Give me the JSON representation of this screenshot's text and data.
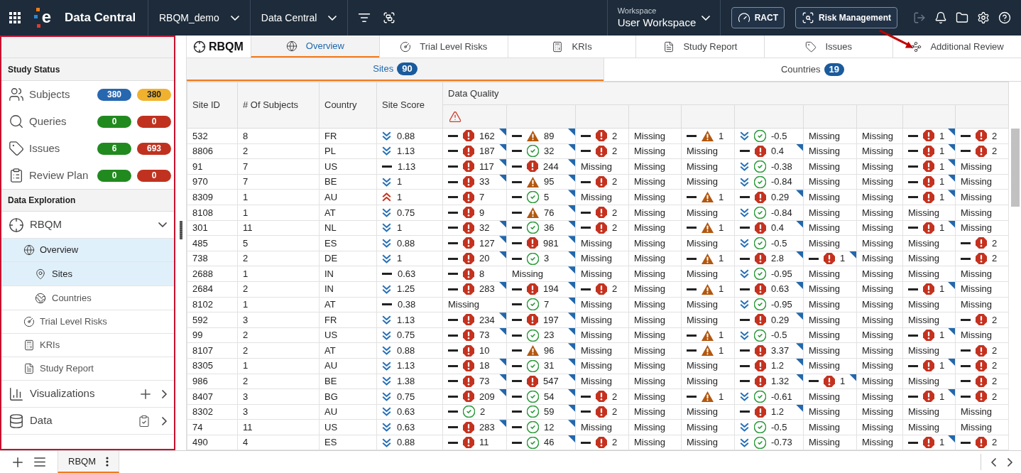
{
  "top_bar": {
    "logo_letter": "e",
    "app_name": "Data Central",
    "selectors": [
      {
        "label": "RBQM_demo"
      },
      {
        "label": "Data Central"
      }
    ],
    "workspace": {
      "label": "Workspace",
      "value": "User Workspace"
    },
    "buttons": [
      {
        "kind": "ract",
        "label": "RACT"
      },
      {
        "kind": "risk_management",
        "label": "Risk Management"
      }
    ],
    "actions": [
      {
        "kind": "logout",
        "disabled": true
      },
      {
        "kind": "notifications",
        "disabled": false
      },
      {
        "kind": "folder",
        "disabled": false
      },
      {
        "kind": "settings",
        "disabled": false
      },
      {
        "kind": "help",
        "disabled": false
      }
    ]
  },
  "study_status": {
    "title": "Study Status",
    "items": [
      {
        "kind": "subjects",
        "label": "Subjects",
        "badges": [
          {
            "text": "380",
            "color": "#2767b0"
          },
          {
            "text": "380",
            "color": "#f0b22e"
          }
        ]
      },
      {
        "kind": "queries",
        "label": "Queries",
        "badges": [
          {
            "text": "0",
            "color": "#218a1f"
          },
          {
            "text": "0",
            "color": "#c0321f"
          }
        ]
      },
      {
        "kind": "issues",
        "label": "Issues",
        "badges": [
          {
            "text": "6",
            "color": "#218a1f"
          },
          {
            "text": "693",
            "color": "#c0321f"
          }
        ]
      },
      {
        "kind": "review_plan",
        "label": "Review Plan",
        "badges": [
          {
            "text": "0",
            "color": "#218a1f"
          },
          {
            "text": "0",
            "color": "#c0321f"
          }
        ]
      }
    ]
  },
  "data_exploration": {
    "title": "Data Exploration",
    "items": [
      {
        "kind": "rbqm",
        "label": "RBQM",
        "selected": false,
        "expanded": true,
        "children": [
          {
            "kind": "overview",
            "label": "Overview",
            "selected": true,
            "children": [
              {
                "kind": "sites",
                "label": "Sites",
                "selected": true
              },
              {
                "kind": "countries",
                "label": "Countries",
                "selected": false
              }
            ]
          },
          {
            "kind": "trial_level_risks",
            "label": "Trial Level Risks",
            "selected": false
          },
          {
            "kind": "kris",
            "label": "KRIs",
            "selected": false
          },
          {
            "kind": "study_report",
            "label": "Study Report",
            "selected": false
          }
        ]
      },
      {
        "kind": "visualizations",
        "label": "Visualizations",
        "selected": false,
        "expanded": false
      },
      {
        "kind": "data",
        "label": "Data",
        "selected": false,
        "expanded": false
      }
    ]
  },
  "module": {
    "title": "RBQM",
    "tabs": [
      {
        "kind": "overview",
        "label": "Overview",
        "selected": true
      },
      {
        "kind": "trial_level_risks",
        "label": "Trial Level Risks",
        "selected": false
      },
      {
        "kind": "kris",
        "label": "KRIs",
        "selected": false
      },
      {
        "kind": "study_report",
        "label": "Study Report",
        "selected": false
      },
      {
        "kind": "issues",
        "label": "Issues",
        "selected": false
      },
      {
        "kind": "additional_review",
        "label": "Additional Review",
        "selected": false
      }
    ]
  },
  "sub_tabs": [
    {
      "label": "Sites",
      "count": "90",
      "selected": true
    },
    {
      "label": "Countries",
      "count": "19",
      "selected": false
    }
  ],
  "table": {
    "columns": [
      {
        "label": "Site ID"
      },
      {
        "label": "# Of Subjects"
      },
      {
        "label": "Country"
      },
      {
        "label": "Site Score"
      }
    ],
    "group": {
      "label": "Data Quality",
      "columns": [
        {
          "alert": true
        },
        {
          "alert": false
        },
        {
          "alert": false
        },
        {
          "alert": false
        },
        {
          "alert": false
        },
        {
          "alert": false
        },
        {
          "alert": false
        },
        {
          "alert": false
        },
        {
          "alert": false
        },
        {
          "alert": false
        }
      ]
    },
    "rows": [
      {
        "site_id": "532",
        "subjects": "8",
        "country": "FR",
        "score": {
          "kind": "down",
          "value": "0.88"
        },
        "quality": [
          {
            "kind": "flat_error",
            "value": "162",
            "flagged": true
          },
          {
            "kind": "flat_warning",
            "value": "89",
            "flagged": true
          },
          {
            "kind": "flat_error",
            "value": "2",
            "flagged": false
          },
          {
            "kind": "missing",
            "text": "Missing",
            "flagged": false
          },
          {
            "kind": "flat_warning",
            "value": "1",
            "flagged": false
          },
          {
            "kind": "down_ok",
            "value": "-0.5",
            "flagged": false
          },
          {
            "kind": "missing",
            "text": "Missing",
            "flagged": false
          },
          {
            "kind": "missing",
            "text": "Missing",
            "flagged": false
          },
          {
            "kind": "flat_error",
            "value": "1",
            "flagged": true
          },
          {
            "kind": "flat_error",
            "value": "2",
            "flagged": false
          }
        ]
      },
      {
        "site_id": "8806",
        "subjects": "2",
        "country": "PL",
        "score": {
          "kind": "down",
          "value": "1.13"
        },
        "quality": [
          {
            "kind": "flat_error",
            "value": "187",
            "flagged": true
          },
          {
            "kind": "flat_ok",
            "value": "32",
            "flagged": true
          },
          {
            "kind": "flat_error",
            "value": "2",
            "flagged": false
          },
          {
            "kind": "missing",
            "text": "Missing",
            "flagged": false
          },
          {
            "kind": "missing",
            "text": "Missing",
            "flagged": false
          },
          {
            "kind": "flat_error",
            "value": "0.4",
            "flagged": true
          },
          {
            "kind": "missing",
            "text": "Missing",
            "flagged": false
          },
          {
            "kind": "missing",
            "text": "Missing",
            "flagged": false
          },
          {
            "kind": "flat_error",
            "value": "1",
            "flagged": true
          },
          {
            "kind": "flat_error",
            "value": "2",
            "flagged": false
          }
        ]
      },
      {
        "site_id": "91",
        "subjects": "7",
        "country": "US",
        "score": {
          "kind": "flat",
          "value": "1.13"
        },
        "quality": [
          {
            "kind": "flat_error",
            "value": "117",
            "flagged": true
          },
          {
            "kind": "flat_error",
            "value": "244",
            "flagged": true
          },
          {
            "kind": "missing",
            "text": "Missing",
            "flagged": false
          },
          {
            "kind": "missing",
            "text": "Missing",
            "flagged": false
          },
          {
            "kind": "missing",
            "text": "Missing",
            "flagged": false
          },
          {
            "kind": "down_ok",
            "value": "-0.38",
            "flagged": false
          },
          {
            "kind": "missing",
            "text": "Missing",
            "flagged": false
          },
          {
            "kind": "missing",
            "text": "Missing",
            "flagged": false
          },
          {
            "kind": "flat_error",
            "value": "1",
            "flagged": true
          },
          {
            "kind": "missing",
            "text": "Missing",
            "flagged": false
          }
        ]
      },
      {
        "site_id": "970",
        "subjects": "7",
        "country": "BE",
        "score": {
          "kind": "down",
          "value": "1"
        },
        "quality": [
          {
            "kind": "flat_error",
            "value": "33",
            "flagged": true
          },
          {
            "kind": "flat_warning",
            "value": "95",
            "flagged": true
          },
          {
            "kind": "flat_error",
            "value": "2",
            "flagged": false
          },
          {
            "kind": "missing",
            "text": "Missing",
            "flagged": false
          },
          {
            "kind": "missing",
            "text": "Missing",
            "flagged": false
          },
          {
            "kind": "down_ok",
            "value": "-0.84",
            "flagged": false
          },
          {
            "kind": "missing",
            "text": "Missing",
            "flagged": false
          },
          {
            "kind": "missing",
            "text": "Missing",
            "flagged": false
          },
          {
            "kind": "flat_error",
            "value": "1",
            "flagged": true
          },
          {
            "kind": "missing",
            "text": "Missing",
            "flagged": false
          }
        ]
      },
      {
        "site_id": "8309",
        "subjects": "1",
        "country": "AU",
        "score": {
          "kind": "up",
          "value": "1"
        },
        "quality": [
          {
            "kind": "flat_error",
            "value": "7",
            "flagged": false
          },
          {
            "kind": "flat_ok",
            "value": "5",
            "flagged": true
          },
          {
            "kind": "missing",
            "text": "Missing",
            "flagged": false
          },
          {
            "kind": "missing",
            "text": "Missing",
            "flagged": false
          },
          {
            "kind": "flat_warning",
            "value": "1",
            "flagged": false
          },
          {
            "kind": "flat_error",
            "value": "0.29",
            "flagged": true
          },
          {
            "kind": "missing",
            "text": "Missing",
            "flagged": false
          },
          {
            "kind": "missing",
            "text": "Missing",
            "flagged": false
          },
          {
            "kind": "flat_error",
            "value": "1",
            "flagged": true
          },
          {
            "kind": "missing",
            "text": "Missing",
            "flagged": false
          }
        ]
      },
      {
        "site_id": "8108",
        "subjects": "1",
        "country": "AT",
        "score": {
          "kind": "down",
          "value": "0.75"
        },
        "quality": [
          {
            "kind": "flat_error",
            "value": "9",
            "flagged": false
          },
          {
            "kind": "flat_warning",
            "value": "76",
            "flagged": true
          },
          {
            "kind": "flat_error",
            "value": "2",
            "flagged": false
          },
          {
            "kind": "missing",
            "text": "Missing",
            "flagged": false
          },
          {
            "kind": "missing",
            "text": "Missing",
            "flagged": false
          },
          {
            "kind": "down_ok",
            "value": "-0.84",
            "flagged": false
          },
          {
            "kind": "missing",
            "text": "Missing",
            "flagged": false
          },
          {
            "kind": "missing",
            "text": "Missing",
            "flagged": false
          },
          {
            "kind": "missing",
            "text": "Missing",
            "flagged": false
          },
          {
            "kind": "missing",
            "text": "Missing",
            "flagged": false
          }
        ]
      },
      {
        "site_id": "301",
        "subjects": "11",
        "country": "NL",
        "score": {
          "kind": "down",
          "value": "1"
        },
        "quality": [
          {
            "kind": "flat_error",
            "value": "32",
            "flagged": true
          },
          {
            "kind": "flat_ok",
            "value": "36",
            "flagged": true
          },
          {
            "kind": "flat_error",
            "value": "2",
            "flagged": false
          },
          {
            "kind": "missing",
            "text": "Missing",
            "flagged": false
          },
          {
            "kind": "flat_warning",
            "value": "1",
            "flagged": false
          },
          {
            "kind": "flat_error",
            "value": "0.4",
            "flagged": true
          },
          {
            "kind": "missing",
            "text": "Missing",
            "flagged": false
          },
          {
            "kind": "missing",
            "text": "Missing",
            "flagged": false
          },
          {
            "kind": "flat_error",
            "value": "1",
            "flagged": true
          },
          {
            "kind": "missing",
            "text": "Missing",
            "flagged": false
          }
        ]
      },
      {
        "site_id": "485",
        "subjects": "5",
        "country": "ES",
        "score": {
          "kind": "down",
          "value": "0.88"
        },
        "quality": [
          {
            "kind": "flat_error",
            "value": "127",
            "flagged": true
          },
          {
            "kind": "flat_error",
            "value": "981",
            "flagged": true
          },
          {
            "kind": "missing",
            "text": "Missing",
            "flagged": false
          },
          {
            "kind": "missing",
            "text": "Missing",
            "flagged": false
          },
          {
            "kind": "missing",
            "text": "Missing",
            "flagged": false
          },
          {
            "kind": "down_ok",
            "value": "-0.5",
            "flagged": false
          },
          {
            "kind": "missing",
            "text": "Missing",
            "flagged": false
          },
          {
            "kind": "missing",
            "text": "Missing",
            "flagged": false
          },
          {
            "kind": "missing",
            "text": "Missing",
            "flagged": false
          },
          {
            "kind": "flat_error",
            "value": "2",
            "flagged": false
          }
        ]
      },
      {
        "site_id": "738",
        "subjects": "2",
        "country": "DE",
        "score": {
          "kind": "down",
          "value": "1"
        },
        "quality": [
          {
            "kind": "flat_error",
            "value": "20",
            "flagged": true
          },
          {
            "kind": "flat_ok",
            "value": "3",
            "flagged": true
          },
          {
            "kind": "missing",
            "text": "Missing",
            "flagged": false
          },
          {
            "kind": "missing",
            "text": "Missing",
            "flagged": false
          },
          {
            "kind": "flat_warning",
            "value": "1",
            "flagged": false
          },
          {
            "kind": "flat_error",
            "value": "2.8",
            "flagged": true
          },
          {
            "kind": "flat_error",
            "value": "1",
            "flagged": true
          },
          {
            "kind": "missing",
            "text": "Missing",
            "flagged": false
          },
          {
            "kind": "missing",
            "text": "Missing",
            "flagged": false
          },
          {
            "kind": "flat_error",
            "value": "2",
            "flagged": false
          }
        ]
      },
      {
        "site_id": "2688",
        "subjects": "1",
        "country": "IN",
        "score": {
          "kind": "flat",
          "value": "0.63"
        },
        "quality": [
          {
            "kind": "flat_error",
            "value": "8",
            "flagged": false
          },
          {
            "kind": "missing",
            "text": "Missing",
            "flagged": true
          },
          {
            "kind": "missing",
            "text": "Missing",
            "flagged": false
          },
          {
            "kind": "missing",
            "text": "Missing",
            "flagged": false
          },
          {
            "kind": "missing",
            "text": "Missing",
            "flagged": false
          },
          {
            "kind": "down_ok",
            "value": "-0.95",
            "flagged": false
          },
          {
            "kind": "missing",
            "text": "Missing",
            "flagged": false
          },
          {
            "kind": "missing",
            "text": "Missing",
            "flagged": false
          },
          {
            "kind": "missing",
            "text": "Missing",
            "flagged": false
          },
          {
            "kind": "missing",
            "text": "Missing",
            "flagged": false
          }
        ]
      },
      {
        "site_id": "2684",
        "subjects": "2",
        "country": "IN",
        "score": {
          "kind": "down",
          "value": "1.25"
        },
        "quality": [
          {
            "kind": "flat_error",
            "value": "283",
            "flagged": true
          },
          {
            "kind": "flat_error",
            "value": "194",
            "flagged": true
          },
          {
            "kind": "flat_error",
            "value": "2",
            "flagged": false
          },
          {
            "kind": "missing",
            "text": "Missing",
            "flagged": false
          },
          {
            "kind": "flat_warning",
            "value": "1",
            "flagged": false
          },
          {
            "kind": "flat_error",
            "value": "0.63",
            "flagged": true
          },
          {
            "kind": "missing",
            "text": "Missing",
            "flagged": false
          },
          {
            "kind": "missing",
            "text": "Missing",
            "flagged": false
          },
          {
            "kind": "flat_error",
            "value": "1",
            "flagged": true
          },
          {
            "kind": "missing",
            "text": "Missing",
            "flagged": false
          }
        ]
      },
      {
        "site_id": "8102",
        "subjects": "1",
        "country": "AT",
        "score": {
          "kind": "flat",
          "value": "0.38"
        },
        "quality": [
          {
            "kind": "missing",
            "text": "Missing",
            "flagged": false
          },
          {
            "kind": "flat_ok",
            "value": "7",
            "flagged": true
          },
          {
            "kind": "missing",
            "text": "Missing",
            "flagged": false
          },
          {
            "kind": "missing",
            "text": "Missing",
            "flagged": false
          },
          {
            "kind": "missing",
            "text": "Missing",
            "flagged": false
          },
          {
            "kind": "down_ok",
            "value": "-0.95",
            "flagged": false
          },
          {
            "kind": "missing",
            "text": "Missing",
            "flagged": false
          },
          {
            "kind": "missing",
            "text": "Missing",
            "flagged": false
          },
          {
            "kind": "missing",
            "text": "Missing",
            "flagged": false
          },
          {
            "kind": "missing",
            "text": "Missing",
            "flagged": false
          }
        ]
      },
      {
        "site_id": "592",
        "subjects": "3",
        "country": "FR",
        "score": {
          "kind": "down",
          "value": "1.13"
        },
        "quality": [
          {
            "kind": "flat_error",
            "value": "234",
            "flagged": true
          },
          {
            "kind": "flat_error",
            "value": "197",
            "flagged": true
          },
          {
            "kind": "missing",
            "text": "Missing",
            "flagged": false
          },
          {
            "kind": "missing",
            "text": "Missing",
            "flagged": false
          },
          {
            "kind": "missing",
            "text": "Missing",
            "flagged": false
          },
          {
            "kind": "flat_error",
            "value": "0.29",
            "flagged": true
          },
          {
            "kind": "missing",
            "text": "Missing",
            "flagged": false
          },
          {
            "kind": "missing",
            "text": "Missing",
            "flagged": false
          },
          {
            "kind": "missing",
            "text": "Missing",
            "flagged": false
          },
          {
            "kind": "flat_error",
            "value": "2",
            "flagged": false
          }
        ]
      },
      {
        "site_id": "99",
        "subjects": "2",
        "country": "US",
        "score": {
          "kind": "down",
          "value": "0.75"
        },
        "quality": [
          {
            "kind": "flat_error",
            "value": "73",
            "flagged": true
          },
          {
            "kind": "flat_ok",
            "value": "23",
            "flagged": true
          },
          {
            "kind": "missing",
            "text": "Missing",
            "flagged": false
          },
          {
            "kind": "missing",
            "text": "Missing",
            "flagged": false
          },
          {
            "kind": "flat_warning",
            "value": "1",
            "flagged": false
          },
          {
            "kind": "down_ok",
            "value": "-0.5",
            "flagged": false
          },
          {
            "kind": "missing",
            "text": "Missing",
            "flagged": false
          },
          {
            "kind": "missing",
            "text": "Missing",
            "flagged": false
          },
          {
            "kind": "flat_error",
            "value": "1",
            "flagged": true
          },
          {
            "kind": "missing",
            "text": "Missing",
            "flagged": false
          }
        ]
      },
      {
        "site_id": "8107",
        "subjects": "2",
        "country": "AT",
        "score": {
          "kind": "down",
          "value": "0.88"
        },
        "quality": [
          {
            "kind": "flat_error",
            "value": "10",
            "flagged": false
          },
          {
            "kind": "flat_warning",
            "value": "96",
            "flagged": true
          },
          {
            "kind": "missing",
            "text": "Missing",
            "flagged": false
          },
          {
            "kind": "missing",
            "text": "Missing",
            "flagged": false
          },
          {
            "kind": "flat_warning",
            "value": "1",
            "flagged": false
          },
          {
            "kind": "flat_error",
            "value": "3.37",
            "flagged": true
          },
          {
            "kind": "missing",
            "text": "Missing",
            "flagged": false
          },
          {
            "kind": "missing",
            "text": "Missing",
            "flagged": false
          },
          {
            "kind": "missing",
            "text": "Missing",
            "flagged": false
          },
          {
            "kind": "flat_error",
            "value": "2",
            "flagged": false
          }
        ]
      },
      {
        "site_id": "8305",
        "subjects": "1",
        "country": "AU",
        "score": {
          "kind": "down",
          "value": "1.13"
        },
        "quality": [
          {
            "kind": "flat_error",
            "value": "18",
            "flagged": true
          },
          {
            "kind": "flat_ok",
            "value": "31",
            "flagged": true
          },
          {
            "kind": "missing",
            "text": "Missing",
            "flagged": false
          },
          {
            "kind": "missing",
            "text": "Missing",
            "flagged": false
          },
          {
            "kind": "missing",
            "text": "Missing",
            "flagged": false
          },
          {
            "kind": "flat_error",
            "value": "1.2",
            "flagged": true
          },
          {
            "kind": "missing",
            "text": "Missing",
            "flagged": false
          },
          {
            "kind": "missing",
            "text": "Missing",
            "flagged": false
          },
          {
            "kind": "flat_error",
            "value": "1",
            "flagged": true
          },
          {
            "kind": "flat_error",
            "value": "2",
            "flagged": false
          }
        ]
      },
      {
        "site_id": "986",
        "subjects": "2",
        "country": "BE",
        "score": {
          "kind": "down",
          "value": "1.38"
        },
        "quality": [
          {
            "kind": "flat_error",
            "value": "73",
            "flagged": true
          },
          {
            "kind": "flat_error",
            "value": "547",
            "flagged": true
          },
          {
            "kind": "missing",
            "text": "Missing",
            "flagged": false
          },
          {
            "kind": "missing",
            "text": "Missing",
            "flagged": false
          },
          {
            "kind": "missing",
            "text": "Missing",
            "flagged": false
          },
          {
            "kind": "flat_error",
            "value": "1.32",
            "flagged": true
          },
          {
            "kind": "flat_error",
            "value": "1",
            "flagged": true
          },
          {
            "kind": "missing",
            "text": "Missing",
            "flagged": false
          },
          {
            "kind": "missing",
            "text": "Missing",
            "flagged": false
          },
          {
            "kind": "flat_error",
            "value": "2",
            "flagged": false
          }
        ]
      },
      {
        "site_id": "8407",
        "subjects": "3",
        "country": "BG",
        "score": {
          "kind": "down",
          "value": "0.75"
        },
        "quality": [
          {
            "kind": "flat_error",
            "value": "209",
            "flagged": true
          },
          {
            "kind": "flat_ok",
            "value": "54",
            "flagged": true
          },
          {
            "kind": "flat_error",
            "value": "2",
            "flagged": false
          },
          {
            "kind": "missing",
            "text": "Missing",
            "flagged": false
          },
          {
            "kind": "flat_warning",
            "value": "1",
            "flagged": false
          },
          {
            "kind": "down_ok",
            "value": "-0.61",
            "flagged": false
          },
          {
            "kind": "missing",
            "text": "Missing",
            "flagged": false
          },
          {
            "kind": "missing",
            "text": "Missing",
            "flagged": false
          },
          {
            "kind": "flat_error",
            "value": "1",
            "flagged": true
          },
          {
            "kind": "flat_error",
            "value": "2",
            "flagged": false
          }
        ]
      },
      {
        "site_id": "8302",
        "subjects": "3",
        "country": "AU",
        "score": {
          "kind": "down",
          "value": "0.63"
        },
        "quality": [
          {
            "kind": "flat_ok",
            "value": "2",
            "flagged": false
          },
          {
            "kind": "flat_ok",
            "value": "59",
            "flagged": true
          },
          {
            "kind": "flat_error",
            "value": "2",
            "flagged": false
          },
          {
            "kind": "missing",
            "text": "Missing",
            "flagged": false
          },
          {
            "kind": "missing",
            "text": "Missing",
            "flagged": false
          },
          {
            "kind": "flat_error",
            "value": "1.2",
            "flagged": true
          },
          {
            "kind": "missing",
            "text": "Missing",
            "flagged": false
          },
          {
            "kind": "missing",
            "text": "Missing",
            "flagged": false
          },
          {
            "kind": "missing",
            "text": "Missing",
            "flagged": false
          },
          {
            "kind": "missing",
            "text": "Missing",
            "flagged": false
          }
        ]
      },
      {
        "site_id": "74",
        "subjects": "11",
        "country": "US",
        "score": {
          "kind": "down",
          "value": "0.63"
        },
        "quality": [
          {
            "kind": "flat_error",
            "value": "283",
            "flagged": true
          },
          {
            "kind": "flat_ok",
            "value": "12",
            "flagged": true
          },
          {
            "kind": "missing",
            "text": "Missing",
            "flagged": false
          },
          {
            "kind": "missing",
            "text": "Missing",
            "flagged": false
          },
          {
            "kind": "missing",
            "text": "Missing",
            "flagged": false
          },
          {
            "kind": "down_ok",
            "value": "-0.5",
            "flagged": false
          },
          {
            "kind": "missing",
            "text": "Missing",
            "flagged": false
          },
          {
            "kind": "missing",
            "text": "Missing",
            "flagged": false
          },
          {
            "kind": "missing",
            "text": "Missing",
            "flagged": false
          },
          {
            "kind": "missing",
            "text": "Missing",
            "flagged": false
          }
        ]
      },
      {
        "site_id": "490",
        "subjects": "4",
        "country": "ES",
        "score": {
          "kind": "down",
          "value": "0.88"
        },
        "quality": [
          {
            "kind": "flat_error",
            "value": "11",
            "flagged": false
          },
          {
            "kind": "flat_ok",
            "value": "46",
            "flagged": true
          },
          {
            "kind": "flat_error",
            "value": "2",
            "flagged": false
          },
          {
            "kind": "missing",
            "text": "Missing",
            "flagged": false
          },
          {
            "kind": "missing",
            "text": "Missing",
            "flagged": false
          },
          {
            "kind": "down_ok",
            "value": "-0.73",
            "flagged": false
          },
          {
            "kind": "missing",
            "text": "Missing",
            "flagged": false
          },
          {
            "kind": "missing",
            "text": "Missing",
            "flagged": false
          },
          {
            "kind": "flat_error",
            "value": "1",
            "flagged": true
          },
          {
            "kind": "flat_error",
            "value": "2",
            "flagged": false
          }
        ]
      }
    ]
  },
  "bottom_bar": {
    "tabs": [
      {
        "label": "RBQM",
        "selected": true
      }
    ]
  }
}
